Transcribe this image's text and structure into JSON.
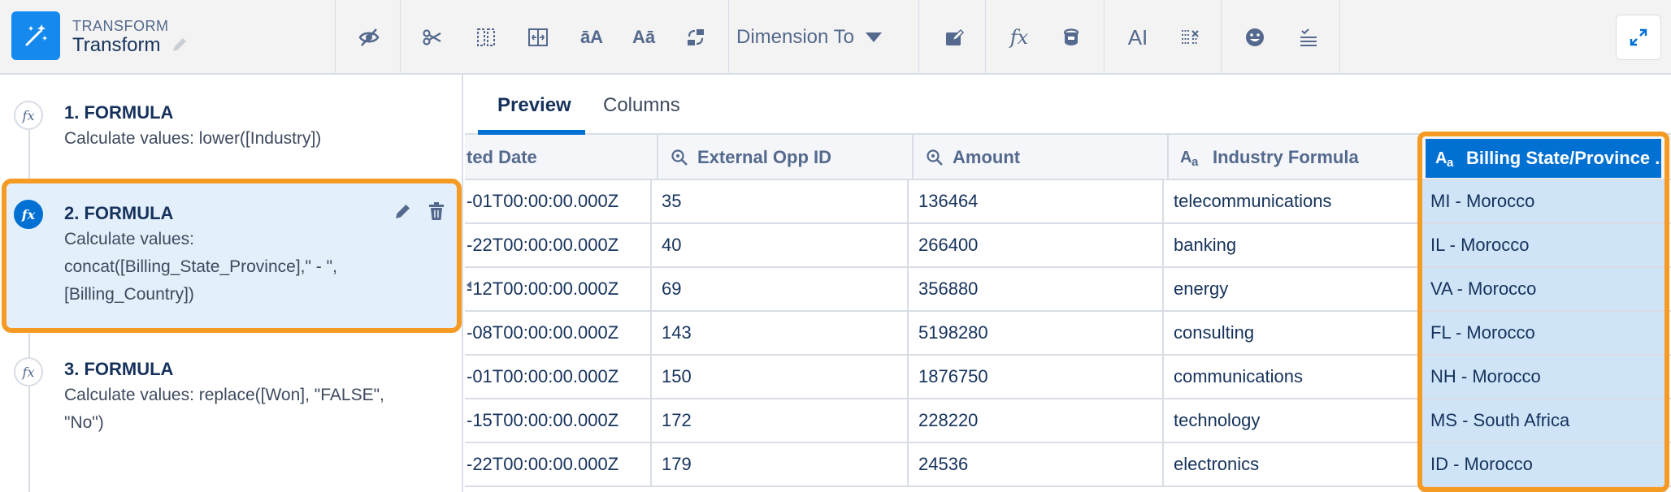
{
  "app": {
    "eyebrow": "TRANSFORM",
    "title": "Transform",
    "icon": "magic-wand-icon",
    "accent": "#1589ee"
  },
  "toolbar": {
    "icons": [
      "hide-eye-icon",
      "scissors-icon",
      "split-column-icon",
      "resize-column-icon",
      "lowercase-icon",
      "uppercase-icon",
      "replace-icon",
      "edit-tag-icon",
      "formula-icon",
      "bucket-icon",
      "text-cursor-icon",
      "clear-format-icon",
      "smiley-icon",
      "filter-lines-icon",
      "expand-icon"
    ],
    "lowercase_label": "āA",
    "uppercase_label": "Aā",
    "formula_label": "fx",
    "text_cursor_label": "AI",
    "dimension_select": "Dimension To"
  },
  "steps": [
    {
      "number_title": "1. FORMULA",
      "description": "Calculate values: lower([Industry])"
    },
    {
      "number_title": "2. FORMULA",
      "description": "Calculate values: concat([Billing_State_Province],\" - \", [Billing_Country])"
    },
    {
      "number_title": "3. FORMULA",
      "description": "Calculate values: replace([Won], \"FALSE\", \"No\")"
    }
  ],
  "step_icon_label": "fx",
  "tabs": [
    {
      "label": "Preview",
      "active": true
    },
    {
      "label": "Columns",
      "active": false
    }
  ],
  "columns": [
    {
      "label": "ted Date",
      "type": "date"
    },
    {
      "label": "External Opp ID",
      "type": "measure"
    },
    {
      "label": "Amount",
      "type": "measure"
    },
    {
      "label": "Industry Formula",
      "type": "text"
    },
    {
      "label": "Billing State/Province ...",
      "type": "text",
      "highlighted": true
    }
  ],
  "rows": [
    [
      "-01T00:00:00.000Z",
      "35",
      "136464",
      "telecommunications",
      "MI - Morocco"
    ],
    [
      "-22T00:00:00.000Z",
      "40",
      "266400",
      "banking",
      "IL - Morocco"
    ],
    [
      "-12T00:00:00.000Z",
      "69",
      "356880",
      "energy",
      "VA - Morocco"
    ],
    [
      "-08T00:00:00.000Z",
      "143",
      "5198280",
      "consulting",
      "FL - Morocco"
    ],
    [
      "-01T00:00:00.000Z",
      "150",
      "1876750",
      "communications",
      "NH - Morocco"
    ],
    [
      "-15T00:00:00.000Z",
      "172",
      "228220",
      "technology",
      "MS - South Africa"
    ],
    [
      "-22T00:00:00.000Z",
      "179",
      "24536",
      "electronics",
      "ID - Morocco"
    ]
  ],
  "colors": {
    "highlight": "#f59a23",
    "selected_bg": "#e3effa",
    "column_bg": "#cfe4f7",
    "column_header": "#0070d2"
  }
}
